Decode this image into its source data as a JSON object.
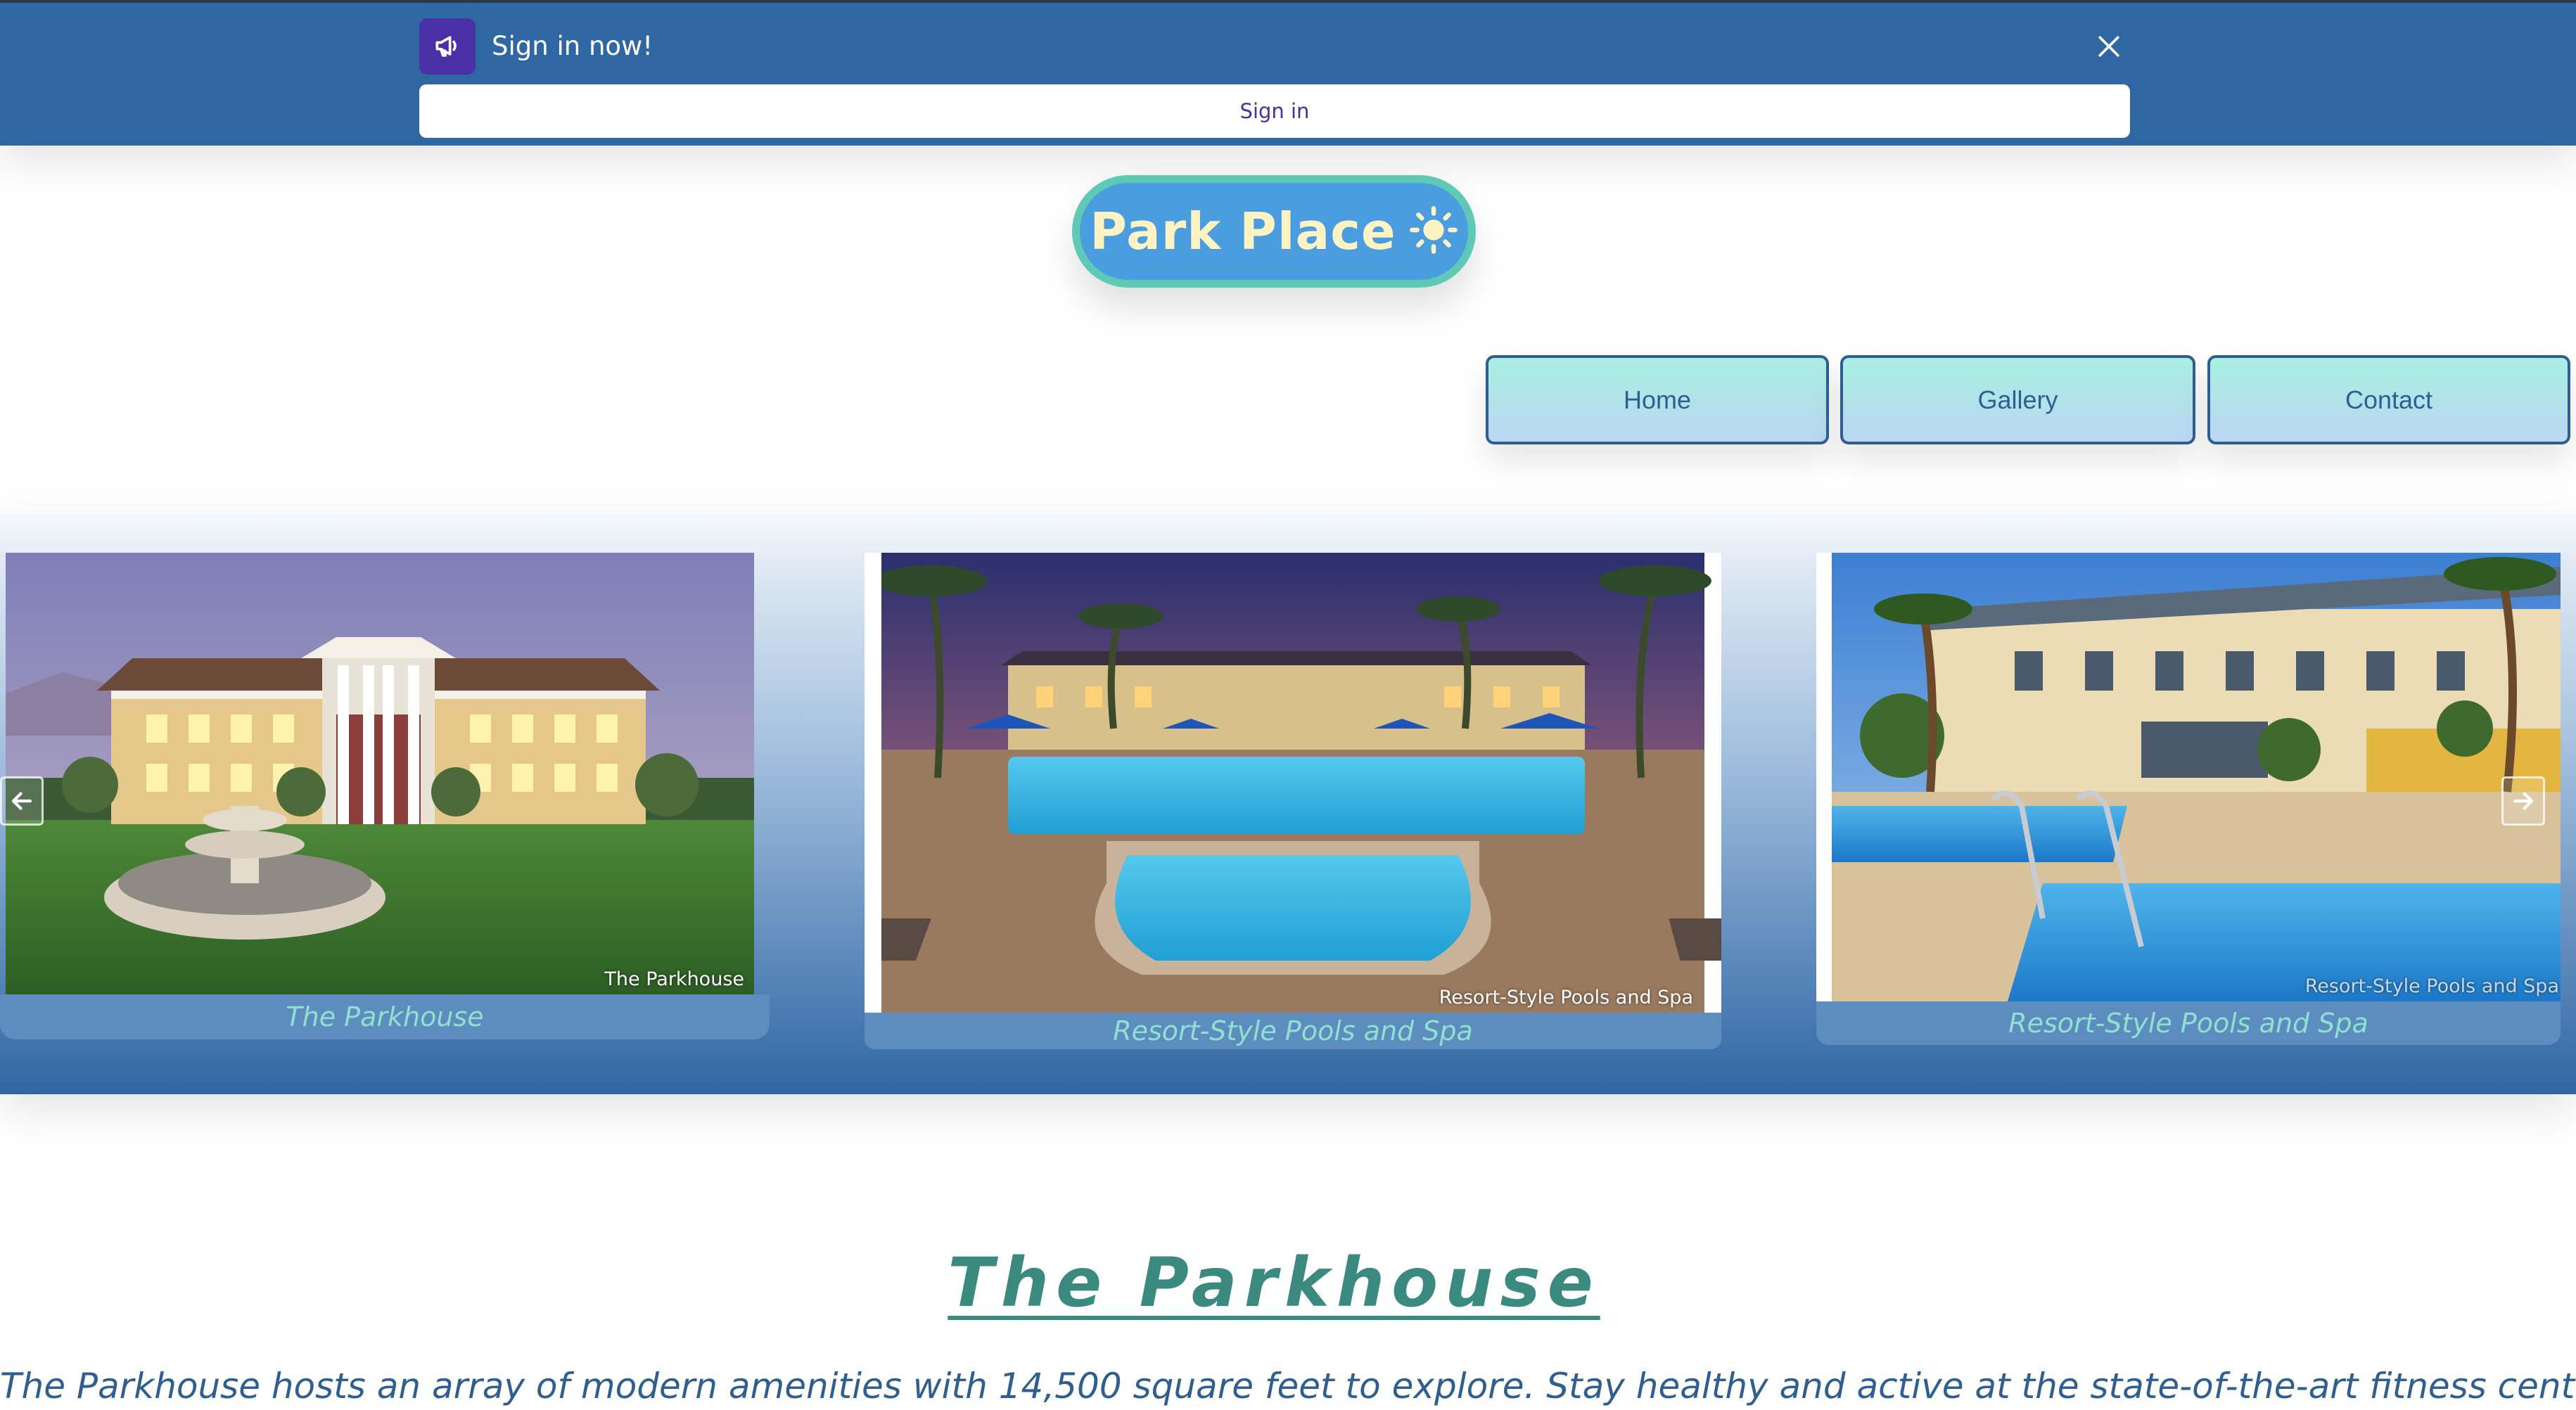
{
  "banner": {
    "icon": "megaphone-icon",
    "title": "Sign in now!",
    "close_icon": "close-icon",
    "button_label": "Sign in",
    "background_color": "#2e67a2",
    "accent_color": "#4a2fa6"
  },
  "logo": {
    "text": "Park Place",
    "icon": "sun-icon"
  },
  "nav": {
    "items": [
      {
        "label": "Home"
      },
      {
        "label": "Gallery"
      },
      {
        "label": "Contact"
      }
    ]
  },
  "carousel": {
    "prev_icon": "arrow-left-icon",
    "next_icon": "arrow-right-icon",
    "slides": [
      {
        "image_caption": "The Parkhouse",
        "caption": "The Parkhouse"
      },
      {
        "image_caption": "Resort-Style Pools and Spa",
        "caption": "Resort-Style Pools and Spa"
      },
      {
        "image_caption": "Resort-Style Pools and Spa",
        "caption": "Resort-Style Pools and Spa"
      }
    ]
  },
  "article": {
    "title": "The Parkhouse",
    "body": "The Parkhouse hosts an array of modern amenities with 14,500 square feet to explore. Stay healthy and active at the state-of-the-art fitness center,"
  }
}
